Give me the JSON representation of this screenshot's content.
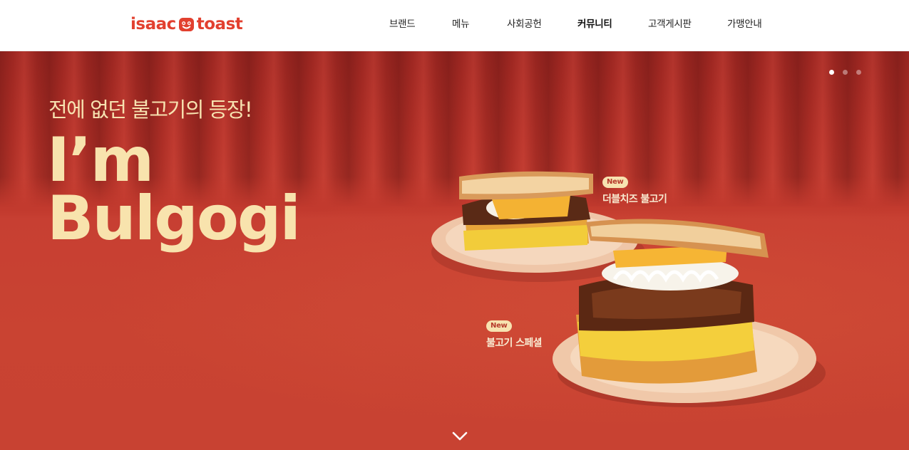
{
  "header": {
    "logo": {
      "left": "isaac",
      "right": "toast"
    },
    "nav": [
      {
        "label": "브랜드",
        "bold": false
      },
      {
        "label": "메뉴",
        "bold": false
      },
      {
        "label": "사회공헌",
        "bold": false
      },
      {
        "label": "커뮤니티",
        "bold": true
      },
      {
        "label": "고객게시판",
        "bold": false
      },
      {
        "label": "가맹안내",
        "bold": false
      }
    ]
  },
  "hero": {
    "subtitle": "전에 없던 불고기의 등장!",
    "title_line1": "I’m",
    "title_line2": "Bulgogi",
    "slides": {
      "total": 3,
      "active": 1
    },
    "products": [
      {
        "badge": "New",
        "name": "더블치즈 불고기"
      },
      {
        "badge": "New",
        "name": "불고기 스페셜"
      }
    ]
  },
  "colors": {
    "brand_red": "#e2402f",
    "hero_red": "#c23a2e",
    "hero_text": "#f8e3ad"
  },
  "icons": {
    "logo_face": "smile-face-icon",
    "scroll": "chevron-down-icon"
  }
}
